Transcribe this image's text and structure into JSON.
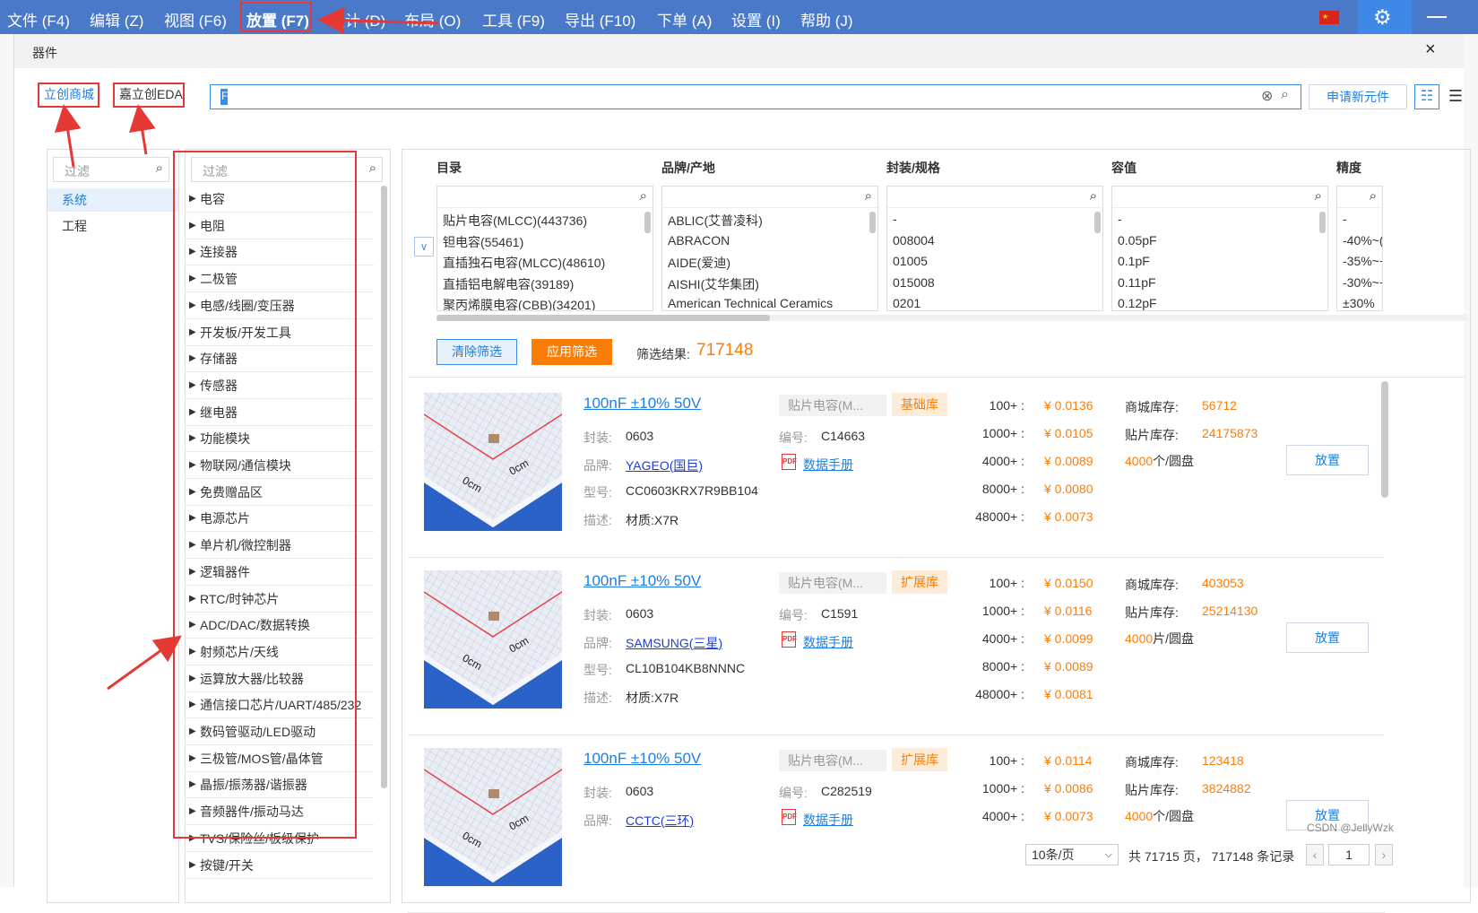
{
  "menubar": {
    "items": [
      "文件 (F4)",
      "编辑 (Z)",
      "视图 (F6)",
      "放置 (F7)",
      "设计 (D)",
      "布局 (O)",
      "工具 (F9)",
      "导出 (F10)",
      "下单 (A)",
      "设置 (I)",
      "帮助 (J)"
    ]
  },
  "dialog": {
    "title": "器件",
    "close": "×"
  },
  "tabs": [
    "立创商城",
    "嘉立创EDA"
  ],
  "search": {
    "value": "F",
    "apply_new": "申请新元件"
  },
  "nav": {
    "filter_placeholder": "过滤",
    "items": [
      "系统",
      "工程"
    ]
  },
  "categories": {
    "filter_placeholder": "过滤",
    "items": [
      "电容",
      "电阻",
      "连接器",
      "二极管",
      "电感/线圈/变压器",
      "开发板/开发工具",
      "存储器",
      "传感器",
      "继电器",
      "功能模块",
      "物联网/通信模块",
      "免费赠品区",
      "电源芯片",
      "单片机/微控制器",
      "逻辑器件",
      "RTC/时钟芯片",
      "ADC/DAC/数据转换",
      "射频芯片/天线",
      "运算放大器/比较器",
      "通信接口芯片/UART/485/232",
      "数码管驱动/LED驱动",
      "三极管/MOS管/晶体管",
      "晶振/振荡器/谐振器",
      "音频器件/振动马达",
      "TVS/保险丝/板级保护",
      "按键/开关"
    ]
  },
  "filters": [
    {
      "header": "目录",
      "options": [
        "贴片电容(MLCC)(443736)",
        "钽电容(55461)",
        "直插独石电容(MLCC)(48610)",
        "直插铝电解电容(39189)",
        "聚丙烯膜电容(CBB)(34201)"
      ]
    },
    {
      "header": "品牌/产地",
      "options": [
        "ABLIC(艾普凌科)",
        "ABRACON",
        "AIDE(爱迪)",
        "AISHI(艾华集团)",
        "American Technical Ceramics"
      ]
    },
    {
      "header": "封装/规格",
      "options": [
        "-",
        "008004",
        "01005",
        "015008",
        "0201"
      ]
    },
    {
      "header": "容值",
      "options": [
        "-",
        "0.05pF",
        "0.1pF",
        "0.11pF",
        "0.12pF"
      ]
    },
    {
      "header": "精度",
      "options": [
        "-",
        "-40%~(",
        "-35%~+",
        "-30%~+",
        "±30%"
      ]
    }
  ],
  "filter_actions": {
    "clear": "清除筛选",
    "apply": "应用筛选",
    "result_label": "筛选结果:",
    "result_value": "717148"
  },
  "products": [
    {
      "title": "100nF ±10% 50V",
      "category": "贴片电容(M...",
      "library": "基础库",
      "fields": [
        [
          "封装:",
          "0603"
        ],
        [
          "品牌:",
          "YAGEO(国巨)"
        ],
        [
          "型号:",
          "CC0603KRX7R9BB104"
        ],
        [
          "描述:",
          "材质:X7R"
        ]
      ],
      "code_label": "编号:",
      "code": "C14663",
      "datasheet": "数据手册",
      "prices": [
        [
          "100+ :",
          "¥ 0.0136"
        ],
        [
          "1000+ :",
          "¥ 0.0105"
        ],
        [
          "4000+ :",
          "¥ 0.0089"
        ],
        [
          "8000+ :",
          "¥ 0.0080"
        ],
        [
          "48000+ :",
          "¥ 0.0073"
        ]
      ],
      "stock": [
        [
          "商城库存:",
          "56712"
        ],
        [
          "贴片库存:",
          "24175873"
        ]
      ],
      "reel_qty": "4000",
      "reel_unit": "个/圆盘",
      "place": "放置"
    },
    {
      "title": "100nF ±10% 50V",
      "category": "贴片电容(M...",
      "library": "扩展库",
      "fields": [
        [
          "封装:",
          "0603"
        ],
        [
          "品牌:",
          "SAMSUNG(三星)"
        ],
        [
          "型号:",
          "CL10B104KB8NNNC"
        ],
        [
          "描述:",
          "材质:X7R"
        ]
      ],
      "code_label": "编号:",
      "code": "C1591",
      "datasheet": "数据手册",
      "prices": [
        [
          "100+ :",
          "¥ 0.0150"
        ],
        [
          "1000+ :",
          "¥ 0.0116"
        ],
        [
          "4000+ :",
          "¥ 0.0099"
        ],
        [
          "8000+ :",
          "¥ 0.0089"
        ],
        [
          "48000+ :",
          "¥ 0.0081"
        ]
      ],
      "stock": [
        [
          "商城库存:",
          "403053"
        ],
        [
          "贴片库存:",
          "25214130"
        ]
      ],
      "reel_qty": "4000",
      "reel_unit": "片/圆盘",
      "place": "放置"
    },
    {
      "title": "100nF ±10% 50V",
      "category": "贴片电容(M...",
      "library": "扩展库",
      "fields": [
        [
          "封装:",
          "0603"
        ],
        [
          "品牌:",
          "CCTC(三环)"
        ]
      ],
      "code_label": "编号:",
      "code": "C282519",
      "datasheet": "数据手册",
      "prices": [
        [
          "100+ :",
          "¥ 0.0114"
        ],
        [
          "1000+ :",
          "¥ 0.0086"
        ],
        [
          "4000+ :",
          "¥ 0.0073"
        ]
      ],
      "stock": [
        [
          "商城库存:",
          "123418"
        ],
        [
          "贴片库存:",
          "3824882"
        ]
      ],
      "reel_qty": "4000",
      "reel_unit": "个/圆盘",
      "place": "放置"
    }
  ],
  "pager": {
    "page_size": "10条/页",
    "info": "共 71715 页， 717148 条记录",
    "current": "1",
    "prev": "‹",
    "next": "›"
  },
  "watermark": "CSDN @JellyWzk",
  "colors": {
    "menubar": "#4a79c9",
    "accent": "#1e7fe0",
    "orange": "#fb7d09",
    "annotation_red": "#e53935"
  }
}
